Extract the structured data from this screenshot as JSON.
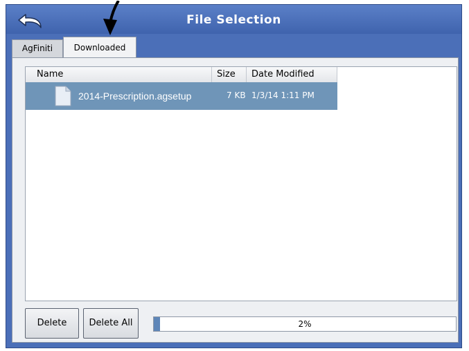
{
  "window": {
    "title": "File Selection"
  },
  "tabs": [
    {
      "label": "AgFiniti",
      "active": false
    },
    {
      "label": "Downloaded",
      "active": true
    }
  ],
  "table": {
    "columns": [
      "Name",
      "Size",
      "Date Modified"
    ],
    "rows": [
      {
        "name": "2014-Prescription.agsetup",
        "size": "7 KB",
        "date": "1/3/14 1:11 PM",
        "selected": true
      }
    ]
  },
  "buttons": {
    "delete": "Delete",
    "delete_all": "Delete All"
  },
  "progress": {
    "value": 2,
    "label": "2%"
  },
  "colors": {
    "frame": "#4b6fb8",
    "selection": "#6f95b8",
    "progress_fill": "#5e86b8"
  },
  "icons": {
    "back": "back-arrow-icon",
    "file": "file-icon",
    "pointer": "pointer-arrow-icon"
  }
}
